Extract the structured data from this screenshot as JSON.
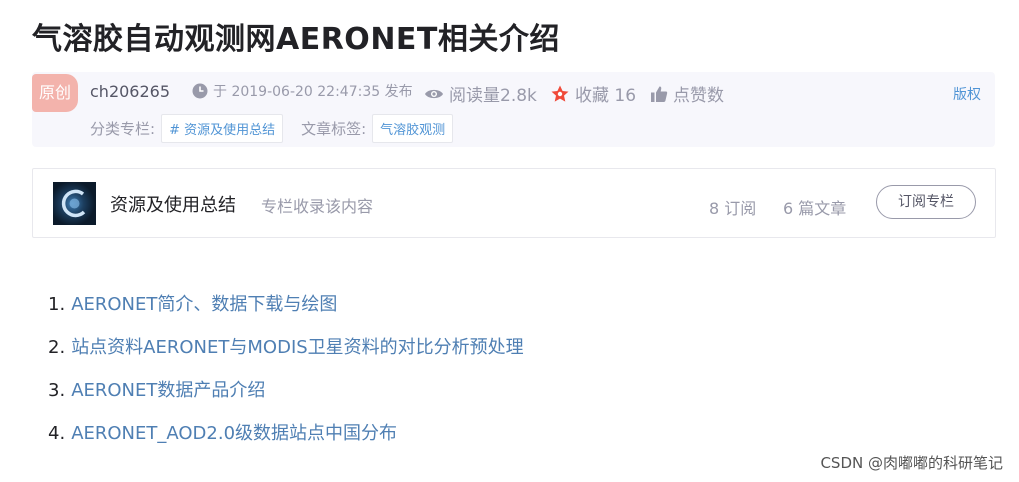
{
  "title": "气溶胶自动观测网AERONET相关介绍",
  "meta": {
    "original_badge": "原创",
    "author": "ch206265",
    "time": "于 2019-06-20 22:47:35 发布",
    "views": "阅读量2.8k",
    "favorites": "收藏 16",
    "likes": "点赞数",
    "copyright": "版权",
    "category_label": "分类专栏:",
    "category_tag": "# 资源及使用总结",
    "tags_label": "文章标签:",
    "tag": "气溶胶观测"
  },
  "column": {
    "name": "资源及使用总结",
    "description": "专栏收录该内容",
    "subscribers": "8 订阅",
    "articles": "6 篇文章",
    "subscribe_button": "订阅专栏"
  },
  "list": [
    {
      "num": "1.",
      "text": "AERONET简介、数据下载与绘图"
    },
    {
      "num": "2.",
      "text": "站点资料AERONET与MODIS卫星资料的对比分析预处理"
    },
    {
      "num": "3.",
      "text": "AERONET数据产品介绍"
    },
    {
      "num": "4.",
      "text": "AERONET_AOD2.0级数据站点中国分布"
    }
  ],
  "watermark": "CSDN @肉嘟嘟的科研笔记",
  "colors": {
    "link": "#4f7fb3",
    "tag": "#5094d5",
    "badge": "#f3b3ac",
    "fav_icon": "#f04a3a"
  },
  "icons": [
    "clock-icon",
    "eye-icon",
    "star-icon",
    "thumb-up-icon"
  ]
}
